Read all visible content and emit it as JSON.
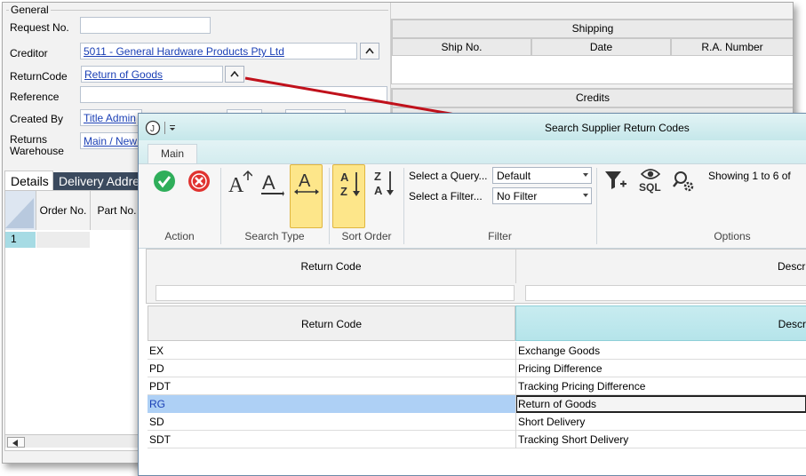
{
  "general": {
    "group_title": "General",
    "request_no_label": "Request No.",
    "request_no_value": "",
    "creditor_label": "Creditor",
    "creditor_value": "5011 - General Hardware Products Pty Ltd",
    "return_code_label": "ReturnCode",
    "return_code_value": "Return of Goods",
    "reference_label": "Reference",
    "reference_value": "",
    "created_by_label": "Created By",
    "created_by_value": "Title Admin",
    "returns_warehouse_label_1": "Returns",
    "returns_warehouse_label_2": "Warehouse",
    "returns_warehouse_value": "Main / New S"
  },
  "shipping": {
    "title": "Shipping",
    "columns": [
      "Ship No.",
      "Date",
      "R.A. Number"
    ]
  },
  "credits": {
    "title": "Credits"
  },
  "bottom_tabs": [
    "Details",
    "Delivery Addre"
  ],
  "details_grid": {
    "columns": [
      "Order No.",
      "Part No."
    ],
    "rows": [
      "1"
    ]
  },
  "dialog": {
    "title": "Search Supplier Return Codes",
    "tab": "Main",
    "groups": [
      "Action",
      "Search Type",
      "Sort Order",
      "Filter",
      "Options"
    ],
    "query_label": "Select a Query...",
    "query_value": "Default",
    "filter_label": "Select a Filter...",
    "filter_value": "No Filter",
    "sql_label": "SQL",
    "showing_text": "Showing 1 to 6 of",
    "filter_header_code": "Return Code",
    "filter_header_desc": "Descri",
    "results_header_code": "Return Code",
    "results_header_desc": "Descr",
    "rows": [
      {
        "code": "EX",
        "desc": "Exchange Goods"
      },
      {
        "code": "PD",
        "desc": "Pricing Difference"
      },
      {
        "code": "PDT",
        "desc": "Tracking Pricing Difference"
      },
      {
        "code": "RG",
        "desc": "Return of Goods"
      },
      {
        "code": "SD",
        "desc": "Short Delivery"
      },
      {
        "code": "SDT",
        "desc": "Tracking Short Delivery"
      }
    ],
    "selected_row": 3
  },
  "colors": {
    "accent_link": "#1a3fb5",
    "selected_row": "#aed0f5",
    "toggle_active": "#fde68a",
    "arrow": "#c0111b",
    "dark_tab": "#3b4a5e"
  }
}
